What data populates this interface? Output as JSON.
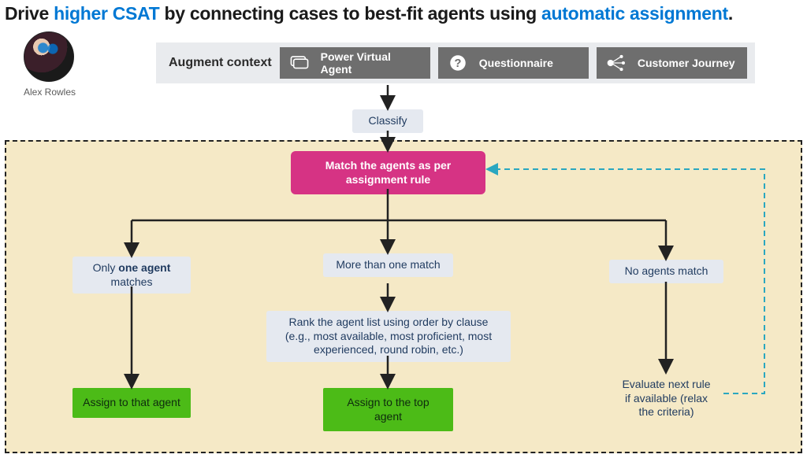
{
  "title": {
    "p1": "Drive ",
    "hl1": "higher CSAT",
    "p2": " by connecting cases to best-fit agents using ",
    "hl2": "automatic assignment",
    "p3": "."
  },
  "avatar": {
    "label": "Alex Rowles"
  },
  "augment": {
    "label": "Augment context",
    "buttons": [
      {
        "label": "Power Virtual Agent",
        "icon": "pva-icon"
      },
      {
        "label": "Questionnaire",
        "icon": "question-icon"
      },
      {
        "label": "Customer Journey",
        "icon": "journey-icon"
      }
    ]
  },
  "nodes": {
    "classify": "Classify",
    "match": "Match the agents as per assignment rule",
    "only_one": "Only one agent matches",
    "more_than": "More than one match",
    "no_match": "No agents match",
    "rank": "Rank the agent list using order by clause (e.g., most available, most proficient, most experienced, round robin, etc.)",
    "assign_that": "Assign to that agent",
    "assign_top": "Assign to the top agent",
    "evaluate": "Evaluate next rule if available (relax the criteria)"
  },
  "colors": {
    "accent": "#0078d4",
    "pink": "#d63384",
    "green": "#4cbb17",
    "sand": "#f5e9c6",
    "dash": "#2aa7c0"
  }
}
